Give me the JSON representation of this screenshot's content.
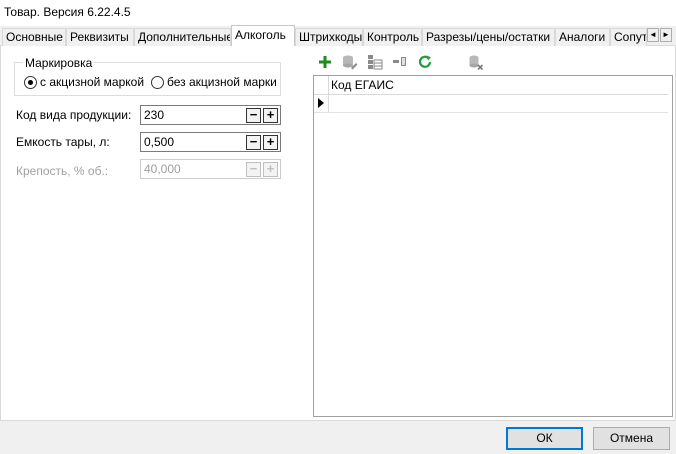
{
  "window": {
    "title": "Товар. Версия 6.22.4.5"
  },
  "tabs": [
    {
      "label": "Основные"
    },
    {
      "label": "Реквизиты"
    },
    {
      "label": "Дополнительные"
    },
    {
      "label": "Алкоголь",
      "active": true
    },
    {
      "label": "Штрихкоды"
    },
    {
      "label": "Контроль"
    },
    {
      "label": "Разрезы/цены/остатки"
    },
    {
      "label": "Аналоги"
    },
    {
      "label": "Сопут"
    }
  ],
  "tab_scroll": {
    "left": "◄",
    "right": "►"
  },
  "marking": {
    "legend": "Маркировка",
    "options": [
      {
        "label": "с акцизной маркой",
        "checked": true
      },
      {
        "label": "без акцизной марки",
        "checked": false
      }
    ]
  },
  "fields": [
    {
      "label": "Код вида продукции:",
      "value": "230",
      "enabled": true
    },
    {
      "label": "Емкость тары, л:",
      "value": "0,500",
      "enabled": true
    },
    {
      "label": "Крепость, % об.:",
      "value": "40,000",
      "enabled": false
    }
  ],
  "spin": {
    "minus": "−",
    "plus": "+"
  },
  "toolbar": {
    "icons": [
      "add-icon",
      "database-edit-icon",
      "table-icon",
      "column-icon",
      "refresh-icon",
      "database-delete-icon"
    ],
    "colors": {
      "add": "#1e8c1e",
      "refresh": "#1e9e3a",
      "disabled": "#9a9a9a"
    }
  },
  "grid": {
    "columns": [
      {
        "label": "Код ЕГАИС"
      }
    ],
    "rows": [
      {
        "value": ""
      }
    ]
  },
  "buttons": {
    "ok": "ОК",
    "cancel": "Отмена"
  },
  "colors": {
    "accent": "#0078d7",
    "window_bg": "#f0f0f0"
  }
}
